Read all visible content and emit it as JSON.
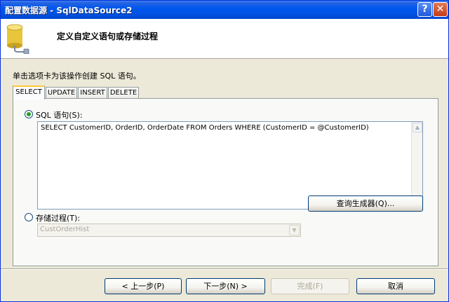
{
  "window": {
    "title": "配置数据源 - SqlDataSource2",
    "help_glyph": "?",
    "close_glyph": "✕"
  },
  "header": {
    "title": "定义自定义语句或存储过程",
    "icon": "database-icon"
  },
  "instruction": "单击选项卡为该操作创建 SQL 语句。",
  "tabs": [
    {
      "label": "SELECT",
      "active": true
    },
    {
      "label": "UPDATE",
      "active": false
    },
    {
      "label": "INSERT",
      "active": false
    },
    {
      "label": "DELETE",
      "active": false
    }
  ],
  "sql_option": {
    "label": "SQL 语句(S):",
    "selected": true,
    "statement": "SELECT CustomerID, OrderID, OrderDate FROM Orders WHERE (CustomerID = @CustomerID)"
  },
  "query_builder_label": "查询生成器(Q)...",
  "sproc_option": {
    "label": "存储过程(T):",
    "selected": false,
    "value": "CustOrderHist"
  },
  "footer": {
    "back": "< 上一步(P)",
    "next": "下一步(N) >",
    "finish": "完成(F)",
    "cancel": "取消"
  },
  "colors": {
    "title_bar": "#0054E3",
    "dialog_bg": "#ECE9D8",
    "selected_radio": "#21A121"
  }
}
